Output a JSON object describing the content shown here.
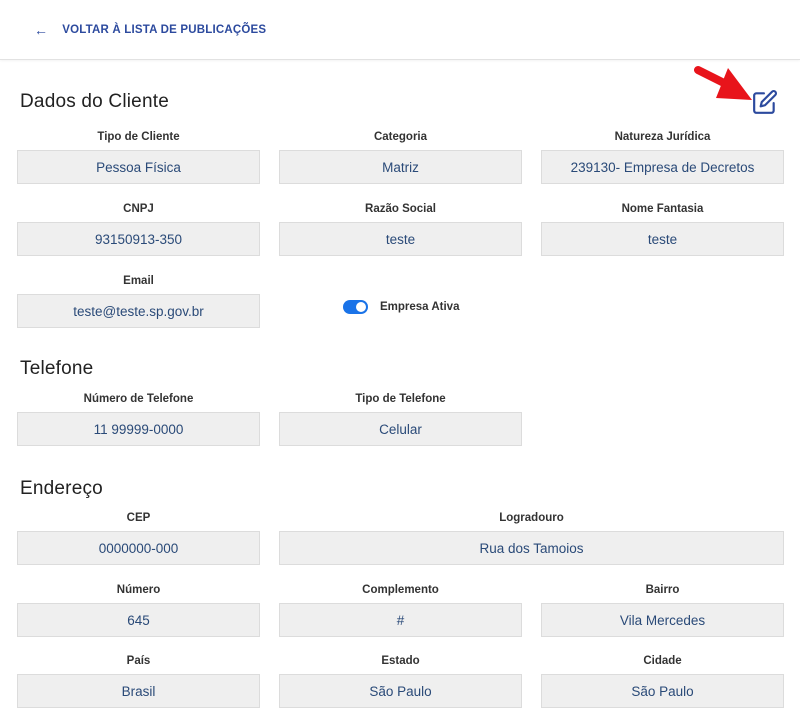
{
  "header": {
    "back_icon": "arrow-left-icon",
    "back_label": "VOLTAR À LISTA DE PUBLICAÇÕES"
  },
  "client": {
    "title": "Dados do Cliente",
    "edit_icon": "pencil-square-icon",
    "tipo_cliente": {
      "label": "Tipo de Cliente",
      "value": "Pessoa Física"
    },
    "categoria": {
      "label": "Categoria",
      "value": "Matriz"
    },
    "natureza": {
      "label": "Natureza Jurídica",
      "value": "239130- Empresa de Decretos"
    },
    "cnpj": {
      "label": "CNPJ",
      "value": "93150913-350"
    },
    "razao_social": {
      "label": "Razão Social",
      "value": "teste"
    },
    "nome_fantasia": {
      "label": "Nome Fantasia",
      "value": "teste"
    },
    "email": {
      "label": "Email",
      "value": "teste@teste.sp.gov.br"
    },
    "empresa_ativa": {
      "label": "Empresa Ativa",
      "on": true
    }
  },
  "phone": {
    "title": "Telefone",
    "numero": {
      "label": "Número de Telefone",
      "value": "11 99999-0000"
    },
    "tipo": {
      "label": "Tipo de Telefone",
      "value": "Celular"
    }
  },
  "address": {
    "title": "Endereço",
    "cep": {
      "label": "CEP",
      "value": "0000000-000"
    },
    "logradouro": {
      "label": "Logradouro",
      "value": "Rua dos Tamoios"
    },
    "numero": {
      "label": "Número",
      "value": "645"
    },
    "complemento": {
      "label": "Complemento",
      "value": "#"
    },
    "bairro": {
      "label": "Bairro",
      "value": "Vila Mercedes"
    },
    "pais": {
      "label": "País",
      "value": "Brasil"
    },
    "estado": {
      "label": "Estado",
      "value": "São Paulo"
    },
    "cidade": {
      "label": "Cidade",
      "value": "São Paulo"
    }
  },
  "colors": {
    "accent": "#2c4a9e",
    "annotation_arrow": "#e8141b",
    "toggle_on": "#1a73e8",
    "field_bg": "#efefef"
  }
}
